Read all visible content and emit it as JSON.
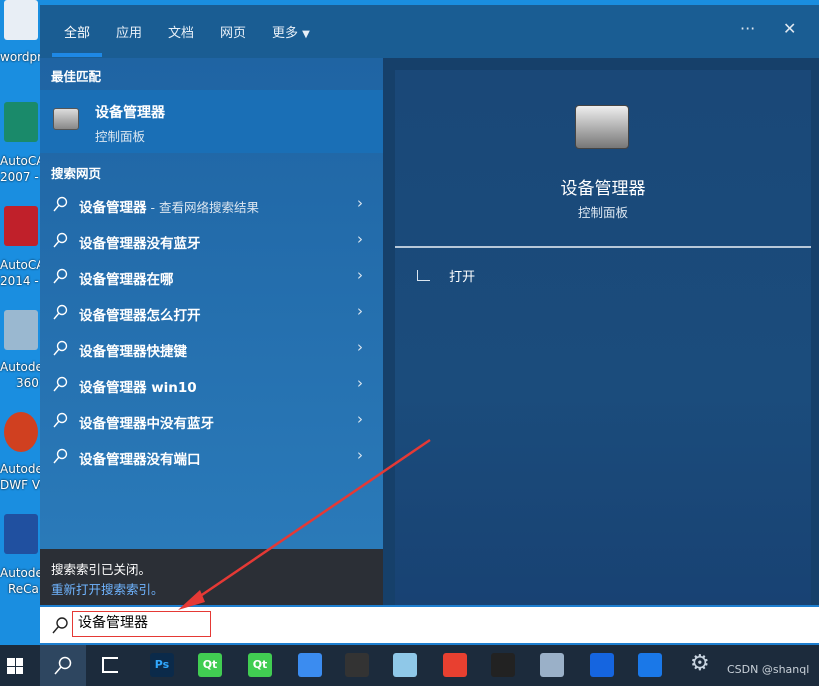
{
  "desktop": {
    "icons": [
      {
        "label": "wordpr",
        "color": "#e8eef5"
      },
      {
        "label": "AutoCA",
        "label2": "2007 -",
        "color": "#1a8a6a"
      },
      {
        "label": "AutoCA",
        "label2": "2014 -",
        "color": "#c0202a"
      },
      {
        "label": "Autode",
        "label2": "360",
        "color": "#9ab8d0"
      },
      {
        "label": "Autode",
        "label2": "DWF Vie",
        "color": "#d04020"
      },
      {
        "label": "Autode",
        "label2": "ReCa",
        "color": "#2050a0"
      }
    ]
  },
  "header": {
    "tabs": [
      "全部",
      "应用",
      "文档",
      "网页",
      "更多"
    ],
    "active": "全部",
    "more_icon": "caret-down",
    "options_label": "···",
    "close_label": "✕"
  },
  "best_match": {
    "heading": "最佳匹配",
    "title": "设备管理器",
    "subtitle": "控制面板",
    "icon": "device-manager-icon"
  },
  "web": {
    "heading": "搜索网页",
    "items": [
      {
        "text": "设备管理器",
        "sub": " - 查看网络搜索结果"
      },
      {
        "text": "设备管理器没有蓝牙"
      },
      {
        "text": "设备管理器在哪"
      },
      {
        "text": "设备管理器怎么打开"
      },
      {
        "text": "设备管理器快捷键"
      },
      {
        "text": "设备管理器 win10"
      },
      {
        "text": "设备管理器中没有蓝牙"
      },
      {
        "text": "设备管理器没有端口"
      }
    ]
  },
  "preview": {
    "title": "设备管理器",
    "subtitle": "控制面板",
    "action": "打开"
  },
  "notice": {
    "text": "搜索索引已关闭。",
    "link": "重新打开搜索索引。"
  },
  "search": {
    "value": "设备管理器"
  },
  "taskbar": {
    "watermark": "CSDN @shanql",
    "apps": [
      {
        "name": "photoshop",
        "label": "Ps",
        "color": "#0b2a4a"
      },
      {
        "name": "qt-creator",
        "label": "Qt",
        "color": "#41cd52"
      },
      {
        "name": "qt-assistant",
        "label": "Qt",
        "color": "#41cd52"
      },
      {
        "name": "feishu",
        "label": "",
        "color": "#3b8cf0"
      },
      {
        "name": "terminal-app",
        "label": "",
        "color": "#333"
      },
      {
        "name": "notepad-app",
        "label": "",
        "color": "#8fc8e8"
      },
      {
        "name": "chrome",
        "label": "",
        "color": "#e84030"
      },
      {
        "name": "inkscape",
        "label": "",
        "color": "#222"
      },
      {
        "name": "monitor-app",
        "label": "",
        "color": "#9ab0c8"
      },
      {
        "name": "security-app-1",
        "label": "",
        "color": "#1565e0"
      },
      {
        "name": "security-app-2",
        "label": "",
        "color": "#1a78e8"
      }
    ]
  },
  "colors": {
    "accent": "#1e88e5",
    "annotation": "#e53935"
  }
}
